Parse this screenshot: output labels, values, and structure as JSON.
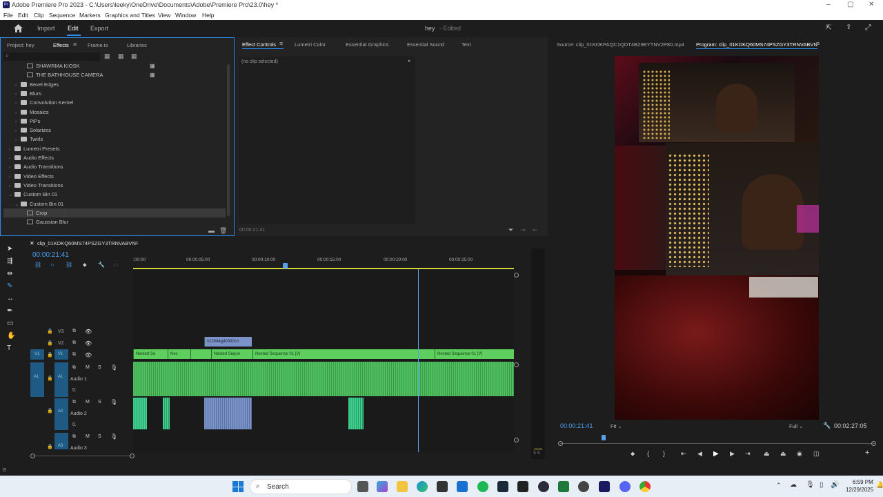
{
  "window": {
    "title": "Adobe Premiere Pro 2023 - C:\\Users\\leeky\\OneDrive\\Documents\\Adobe\\Premiere Pro\\23.0\\hey *",
    "app_badge": "Pr"
  },
  "menu": [
    "File",
    "Edit",
    "Clip",
    "Sequence",
    "Markers",
    "Graphics and Titles",
    "View",
    "Window",
    "Help"
  ],
  "workspace": {
    "tabs": [
      "Import",
      "Edit",
      "Export"
    ],
    "active": "Edit",
    "project_name": "hey",
    "project_status": "- Edited"
  },
  "left_panel": {
    "tabs": [
      "Project: hey",
      "Effects",
      "Frame.io",
      "Libraries"
    ],
    "active_tab": "Effects",
    "search_placeholder": "",
    "tree": [
      {
        "label": "SHAWRMA KIOSK",
        "indent": 2,
        "type": "preset"
      },
      {
        "label": "THE BATHHOUSE CAMERA",
        "indent": 2,
        "type": "preset"
      },
      {
        "label": "Bevel Edges",
        "indent": 1,
        "type": "folder",
        "arrow": "›"
      },
      {
        "label": "Blurs",
        "indent": 1,
        "type": "folder",
        "arrow": "›"
      },
      {
        "label": "Convolution Kernel",
        "indent": 1,
        "type": "folder",
        "arrow": "›"
      },
      {
        "label": "Mosaics",
        "indent": 1,
        "type": "folder",
        "arrow": "›"
      },
      {
        "label": "PiPs",
        "indent": 1,
        "type": "folder",
        "arrow": "›"
      },
      {
        "label": "Solarizes",
        "indent": 1,
        "type": "folder",
        "arrow": "›"
      },
      {
        "label": "Twirls",
        "indent": 1,
        "type": "folder",
        "arrow": "›"
      },
      {
        "label": "Lumetri Presets",
        "indent": 0,
        "type": "folder",
        "arrow": "›"
      },
      {
        "label": "Audio Effects",
        "indent": 0,
        "type": "folder",
        "arrow": "›"
      },
      {
        "label": "Audio Transitions",
        "indent": 0,
        "type": "folder",
        "arrow": "›"
      },
      {
        "label": "Video Effects",
        "indent": 0,
        "type": "folder",
        "arrow": "›"
      },
      {
        "label": "Video Transitions",
        "indent": 0,
        "type": "folder",
        "arrow": "›"
      },
      {
        "label": "Custom Bin 01",
        "indent": 0,
        "type": "folder",
        "arrow": "⌄"
      },
      {
        "label": "Custom Bin 01",
        "indent": 1,
        "type": "folder",
        "arrow": "⌄"
      },
      {
        "label": "Crop",
        "indent": 2,
        "type": "effect",
        "selected": true
      },
      {
        "label": "Gaussian Blur",
        "indent": 2,
        "type": "effect"
      }
    ]
  },
  "effect_controls": {
    "tabs": [
      "Effect Controls",
      "Lumetri Color",
      "Essential Graphics",
      "Essential Sound",
      "Text"
    ],
    "active_tab": "Effect Controls",
    "empty_text": "(no clip selected)",
    "timecode": "00:00:21:41"
  },
  "monitor": {
    "source_tab": "Source: clip_01KDKPAQC1QDT4BZ9EYTNV2P80.mp4",
    "program_tab": "Program: clip_01KDKQ60MS74PSZGY3TRNVABVN",
    "current_timecode": "00:00:21:41",
    "fit": "Fit",
    "quality": "Full",
    "duration": "00:02:27:05"
  },
  "timeline": {
    "sequence_name": "clip_01KDKQ60MS74PSZGY3TRNVABVN",
    "timecode": "00:00:21:41",
    "ruler": [
      ":00:00",
      "00:00:05:00",
      "00:00:10:00",
      "00:00:15:00",
      "00:00:20:00",
      "00:00:25:00"
    ],
    "tracks": {
      "v3": "V3",
      "v2": "V2",
      "v1": "V1",
      "a1": "A1",
      "a2": "A2",
      "a3": "A3",
      "audio1": "Audio 1",
      "audio2": "Audio 2",
      "audio3": "Audio 3",
      "m": "M",
      "s": "S",
      "level": "0."
    },
    "clips_v1": [
      "Nested Se",
      "Nes",
      "Nested Seque",
      "Nested Sequence 01 [V]",
      "Nested Sequence 01 [V]"
    ],
    "clip_v2": "v12044gd0000cn",
    "meter_label": "S S"
  },
  "taskbar": {
    "search_label": "Search",
    "time": "6:59 PM",
    "date": "12/29/2025"
  },
  "colors": {
    "accent": "#2d8ceb",
    "clip_green": "#5ecf5e",
    "audio_green": "#4fbf5f",
    "playhead": "#5aa0e8"
  }
}
